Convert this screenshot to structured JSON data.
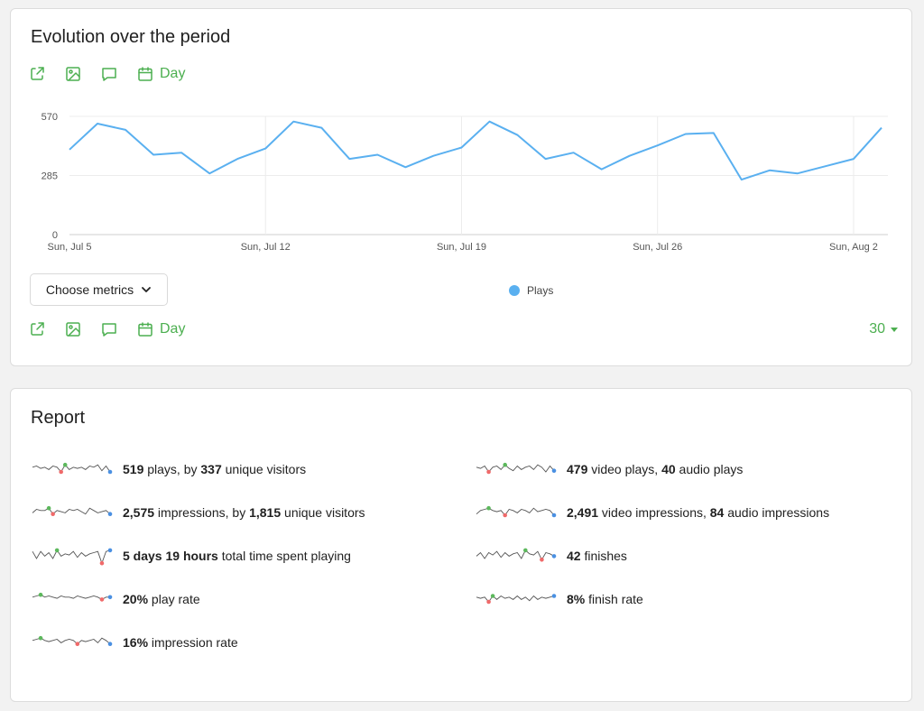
{
  "evolution": {
    "title": "Evolution over the period",
    "toolbar_day_label": "Day",
    "choose_metrics_label": "Choose metrics",
    "limit_value": "30",
    "legend": [
      {
        "label": "Plays",
        "color": "#5ab0f0"
      }
    ]
  },
  "chart_data": {
    "type": "line",
    "title": "",
    "xlabel": "",
    "ylabel": "",
    "ylim": [
      0,
      570
    ],
    "y_ticks": [
      "0",
      "285",
      "570"
    ],
    "x_ticks": [
      "Sun, Jul 5",
      "Sun, Jul 12",
      "Sun, Jul 19",
      "Sun, Jul 26",
      "Sun, Aug 2"
    ],
    "grid": true,
    "legend_position": "bottom",
    "x": [
      "Jul 5",
      "Jul 6",
      "Jul 7",
      "Jul 8",
      "Jul 9",
      "Jul 10",
      "Jul 11",
      "Jul 12",
      "Jul 13",
      "Jul 14",
      "Jul 15",
      "Jul 16",
      "Jul 17",
      "Jul 18",
      "Jul 19",
      "Jul 20",
      "Jul 21",
      "Jul 22",
      "Jul 23",
      "Jul 24",
      "Jul 25",
      "Jul 26",
      "Jul 27",
      "Jul 28",
      "Jul 29",
      "Jul 30",
      "Jul 31",
      "Aug 1",
      "Aug 2",
      "Aug 3"
    ],
    "series": [
      {
        "name": "Plays",
        "color": "#5ab0f0",
        "values": [
          410,
          535,
          505,
          385,
          395,
          295,
          365,
          415,
          545,
          515,
          365,
          385,
          325,
          380,
          420,
          545,
          480,
          365,
          395,
          315,
          380,
          430,
          485,
          490,
          265,
          310,
          295,
          330,
          365,
          515
        ]
      }
    ]
  },
  "report": {
    "title": "Report",
    "items": [
      {
        "parts": [
          {
            "t": "519",
            "b": true
          },
          {
            "t": " plays, by "
          },
          {
            "t": "337",
            "b": true
          },
          {
            "t": " unique visitors"
          }
        ]
      },
      {
        "parts": [
          {
            "t": "479",
            "b": true
          },
          {
            "t": " video plays, "
          },
          {
            "t": "40",
            "b": true
          },
          {
            "t": " audio plays"
          }
        ]
      },
      {
        "parts": [
          {
            "t": "2,575",
            "b": true
          },
          {
            "t": " impressions, by "
          },
          {
            "t": "1,815",
            "b": true
          },
          {
            "t": " unique visitors"
          }
        ]
      },
      {
        "parts": [
          {
            "t": "2,491",
            "b": true
          },
          {
            "t": " video impressions, "
          },
          {
            "t": "84",
            "b": true
          },
          {
            "t": " audio impressions"
          }
        ]
      },
      {
        "parts": [
          {
            "t": "5 days 19 hours",
            "b": true
          },
          {
            "t": " total time spent playing"
          }
        ]
      },
      {
        "parts": [
          {
            "t": "42",
            "b": true
          },
          {
            "t": " finishes"
          }
        ]
      },
      {
        "parts": [
          {
            "t": "20%",
            "b": true
          },
          {
            "t": " play rate"
          }
        ]
      },
      {
        "parts": [
          {
            "t": "8%",
            "b": true
          },
          {
            "t": " finish rate"
          }
        ]
      },
      {
        "parts": [
          {
            "t": "16%",
            "b": true
          },
          {
            "t": " impression rate"
          }
        ]
      }
    ]
  },
  "colors": {
    "accent": "#4caf50",
    "series": "#5ab0f0",
    "spark_max": "#5cb85c",
    "spark_min": "#f06a6a",
    "spark_last": "#4a90e2"
  }
}
